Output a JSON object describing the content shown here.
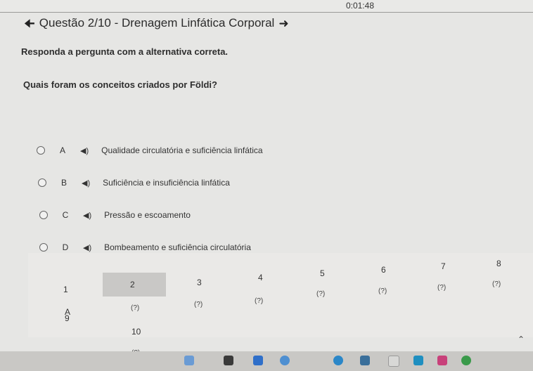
{
  "timer": "0:01:48",
  "header": {
    "title": "Questão 2/10 - Drenagem Linfática Corporal"
  },
  "instruction": "Responda a pergunta com a alternativa correta.",
  "question": "Quais foram os conceitos criados por Földi?",
  "options": [
    {
      "letter": "A",
      "text": "Qualidade circulatória e suficiência linfática"
    },
    {
      "letter": "B",
      "text": "Suficiência e insuficiência linfática"
    },
    {
      "letter": "C",
      "text": "Pressão e escoamento"
    },
    {
      "letter": "D",
      "text": "Bombeamento e suficiência circulatória"
    }
  ],
  "answer_grid": {
    "numbers": [
      "1",
      "2",
      "3",
      "4",
      "5",
      "6",
      "7",
      "8",
      "9",
      "10"
    ],
    "answers": [
      "A",
      "(?)",
      "(?)",
      "(?)",
      "(?)",
      "(?)",
      "(?)",
      "(?)",
      "(?)",
      "(?)"
    ]
  }
}
